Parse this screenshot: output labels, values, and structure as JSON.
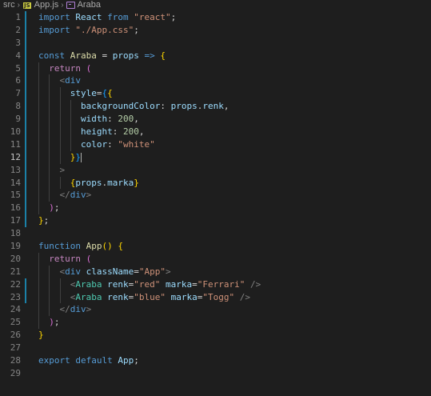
{
  "breadcrumb": {
    "folder": "src",
    "file_badge": "JS",
    "file": "App.js",
    "symbol": "Araba"
  },
  "editor": {
    "active_line": 12,
    "lines": [
      {
        "n": "1",
        "indent": 0,
        "tokens": [
          [
            "kw",
            "import"
          ],
          [
            "op",
            " "
          ],
          [
            "var",
            "React"
          ],
          [
            "op",
            " "
          ],
          [
            "kw",
            "from"
          ],
          [
            "op",
            " "
          ],
          [
            "str",
            "\"react\""
          ],
          [
            "pun",
            ";"
          ]
        ]
      },
      {
        "n": "2",
        "indent": 0,
        "tokens": [
          [
            "kw",
            "import"
          ],
          [
            "op",
            " "
          ],
          [
            "str",
            "\"./App.css\""
          ],
          [
            "pun",
            ";"
          ]
        ]
      },
      {
        "n": "3",
        "indent": 0,
        "tokens": []
      },
      {
        "n": "4",
        "indent": 0,
        "tokens": [
          [
            "kw",
            "const"
          ],
          [
            "op",
            " "
          ],
          [
            "fn",
            "Araba"
          ],
          [
            "op",
            " = "
          ],
          [
            "var",
            "props"
          ],
          [
            "op",
            " "
          ],
          [
            "kw",
            "=>"
          ],
          [
            "op",
            " "
          ],
          [
            "br1",
            "{"
          ]
        ]
      },
      {
        "n": "5",
        "indent": 1,
        "tokens": [
          [
            "ctl",
            "return"
          ],
          [
            "op",
            " "
          ],
          [
            "br2",
            "("
          ]
        ]
      },
      {
        "n": "6",
        "indent": 2,
        "tokens": [
          [
            "ang",
            "<"
          ],
          [
            "htag",
            "div"
          ]
        ]
      },
      {
        "n": "7",
        "indent": 3,
        "tokens": [
          [
            "var",
            "style"
          ],
          [
            "op",
            "="
          ],
          [
            "br3",
            "{"
          ],
          [
            "br1",
            "{"
          ]
        ]
      },
      {
        "n": "8",
        "indent": 4,
        "tokens": [
          [
            "var",
            "backgroundColor"
          ],
          [
            "op",
            ": "
          ],
          [
            "var",
            "props"
          ],
          [
            "pun",
            "."
          ],
          [
            "var",
            "renk"
          ],
          [
            "pun",
            ","
          ]
        ]
      },
      {
        "n": "9",
        "indent": 4,
        "tokens": [
          [
            "var",
            "width"
          ],
          [
            "op",
            ": "
          ],
          [
            "num",
            "200"
          ],
          [
            "pun",
            ","
          ]
        ]
      },
      {
        "n": "10",
        "indent": 4,
        "tokens": [
          [
            "var",
            "height"
          ],
          [
            "op",
            ": "
          ],
          [
            "num",
            "200"
          ],
          [
            "pun",
            ","
          ]
        ]
      },
      {
        "n": "11",
        "indent": 4,
        "tokens": [
          [
            "var",
            "color"
          ],
          [
            "op",
            ": "
          ],
          [
            "str",
            "\"white\""
          ]
        ]
      },
      {
        "n": "12",
        "indent": 3,
        "tokens": [
          [
            "br1",
            "}"
          ],
          [
            "br3",
            "}"
          ]
        ]
      },
      {
        "n": "13",
        "indent": 2,
        "tokens": [
          [
            "ang",
            ">"
          ]
        ]
      },
      {
        "n": "14",
        "indent": 3,
        "tokens": [
          [
            "br1",
            "{"
          ],
          [
            "var",
            "props"
          ],
          [
            "pun",
            "."
          ],
          [
            "var",
            "marka"
          ],
          [
            "br1",
            "}"
          ]
        ]
      },
      {
        "n": "15",
        "indent": 2,
        "tokens": [
          [
            "ang",
            "</"
          ],
          [
            "htag",
            "div"
          ],
          [
            "ang",
            ">"
          ]
        ]
      },
      {
        "n": "16",
        "indent": 1,
        "tokens": [
          [
            "br2",
            ")"
          ],
          [
            "pun",
            ";"
          ]
        ]
      },
      {
        "n": "17",
        "indent": 0,
        "tokens": [
          [
            "br1",
            "}"
          ],
          [
            "pun",
            ";"
          ]
        ]
      },
      {
        "n": "18",
        "indent": 0,
        "tokens": []
      },
      {
        "n": "19",
        "indent": 0,
        "tokens": [
          [
            "kw",
            "function"
          ],
          [
            "op",
            " "
          ],
          [
            "fn",
            "App"
          ],
          [
            "br1",
            "("
          ],
          [
            "br1",
            ")"
          ],
          [
            "op",
            " "
          ],
          [
            "br1",
            "{"
          ]
        ]
      },
      {
        "n": "20",
        "indent": 1,
        "tokens": [
          [
            "ctl",
            "return"
          ],
          [
            "op",
            " "
          ],
          [
            "br2",
            "("
          ]
        ]
      },
      {
        "n": "21",
        "indent": 2,
        "tokens": [
          [
            "ang",
            "<"
          ],
          [
            "htag",
            "div"
          ],
          [
            "op",
            " "
          ],
          [
            "var",
            "className"
          ],
          [
            "op",
            "="
          ],
          [
            "str",
            "\"App\""
          ],
          [
            "ang",
            ">"
          ]
        ]
      },
      {
        "n": "22",
        "indent": 3,
        "tokens": [
          [
            "ang",
            "<"
          ],
          [
            "tag",
            "Araba"
          ],
          [
            "op",
            " "
          ],
          [
            "var",
            "renk"
          ],
          [
            "op",
            "="
          ],
          [
            "str",
            "\"red\""
          ],
          [
            "op",
            " "
          ],
          [
            "var",
            "marka"
          ],
          [
            "op",
            "="
          ],
          [
            "str",
            "\"Ferrari\""
          ],
          [
            "op",
            " "
          ],
          [
            "ang",
            "/>"
          ]
        ]
      },
      {
        "n": "23",
        "indent": 3,
        "tokens": [
          [
            "ang",
            "<"
          ],
          [
            "tag",
            "Araba"
          ],
          [
            "op",
            " "
          ],
          [
            "var",
            "renk"
          ],
          [
            "op",
            "="
          ],
          [
            "str",
            "\"blue\""
          ],
          [
            "op",
            " "
          ],
          [
            "var",
            "marka"
          ],
          [
            "op",
            "="
          ],
          [
            "str",
            "\"Togg\""
          ],
          [
            "op",
            " "
          ],
          [
            "ang",
            "/>"
          ]
        ]
      },
      {
        "n": "24",
        "indent": 2,
        "tokens": [
          [
            "ang",
            "</"
          ],
          [
            "htag",
            "div"
          ],
          [
            "ang",
            ">"
          ]
        ]
      },
      {
        "n": "25",
        "indent": 1,
        "tokens": [
          [
            "br2",
            ")"
          ],
          [
            "pun",
            ";"
          ]
        ]
      },
      {
        "n": "26",
        "indent": 0,
        "tokens": [
          [
            "br1",
            "}"
          ]
        ]
      },
      {
        "n": "27",
        "indent": 0,
        "tokens": []
      },
      {
        "n": "28",
        "indent": 0,
        "tokens": [
          [
            "kw",
            "export"
          ],
          [
            "op",
            " "
          ],
          [
            "kw",
            "default"
          ],
          [
            "op",
            " "
          ],
          [
            "var",
            "App"
          ],
          [
            "pun",
            ";"
          ]
        ]
      },
      {
        "n": "29",
        "indent": 0,
        "tokens": []
      }
    ],
    "modified_lines": [
      "1",
      "2",
      "3",
      "4",
      "5",
      "6",
      "7",
      "8",
      "9",
      "10",
      "11",
      "12",
      "13",
      "14",
      "15",
      "16",
      "17",
      "22",
      "23"
    ],
    "colors": {
      "background": "#1e1e1e",
      "line_number": "#858585",
      "modified_gutter": "#1b81a8",
      "keyword": "#569cd6",
      "control": "#c586c0",
      "string": "#ce9178",
      "number": "#b5cea8",
      "variable": "#9cdcfe",
      "function": "#dcdcaa",
      "component": "#4ec9b0"
    }
  }
}
